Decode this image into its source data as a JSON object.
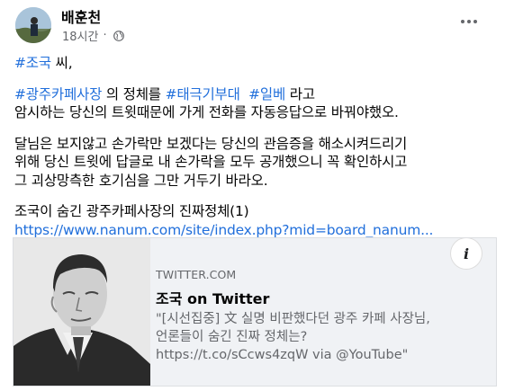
{
  "post": {
    "author": "배훈천",
    "time": "18시간",
    "separator": "·",
    "privacy_icon": "globe-icon",
    "more_icon": "more-horizontal-icon",
    "lines": [
      {
        "tag": "#조국",
        "text": " 씨,"
      },
      {
        "tag1": "#광주카페사장",
        "t1": " 의 정체를 ",
        "tag2": "#태극기부대",
        "t2": "  ",
        "tag3": "#일베",
        "t3": " 라고"
      },
      {
        "text": "암시하는 당신의 트윗때문에 가게 전화를 자동응답으로 바꿔야했오."
      },
      {
        "text": "달님은 보지않고 손가락만 보겠다는 당신의 관음증을 해소시켜드리기"
      },
      {
        "text": "위해 당신 트윗에 답글로 내 손가락을 모두 공개했으니 꼭 확인하시고"
      },
      {
        "text": "그 괴상망측한 호기심을 그만 거두기 바라오."
      },
      {
        "text": "조국이 숨긴 광주카페사장의 진짜정체(1)"
      }
    ],
    "link": "https://www.nanum.com/site/index.php?mid=board_nanum..."
  },
  "preview": {
    "domain": "TWITTER.COM",
    "title": "조국 on Twitter",
    "desc": [
      "\"[시선집중] 文 실명 비판했다던 광주 카페 사장님,",
      "언론들이 숨긴 진짜 정체는?",
      "https://t.co/sCcws4zqW via @YouTube\""
    ],
    "info_label": "i"
  },
  "colors": {
    "link": "#216fdb",
    "secondary": "#65676b",
    "text": "#050505",
    "preview_bg": "#f0f2f5"
  }
}
